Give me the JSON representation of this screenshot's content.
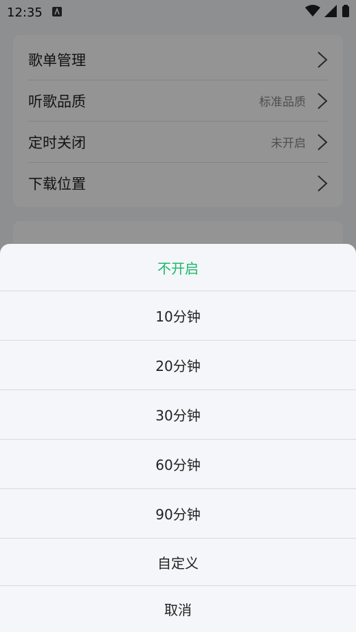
{
  "status_bar": {
    "time": "12:35"
  },
  "settings": {
    "rows": [
      {
        "label": "歌单管理",
        "value": ""
      },
      {
        "label": "听歌品质",
        "value": "标准品质"
      },
      {
        "label": "定时关闭",
        "value": "未开启"
      },
      {
        "label": "下载位置",
        "value": ""
      }
    ]
  },
  "sheet": {
    "accent_color": "#19b96a",
    "options": [
      "不开启",
      "10分钟",
      "20分钟",
      "30分钟",
      "60分钟",
      "90分钟",
      "自定义"
    ],
    "selected_index": 0,
    "cancel": "取消"
  }
}
